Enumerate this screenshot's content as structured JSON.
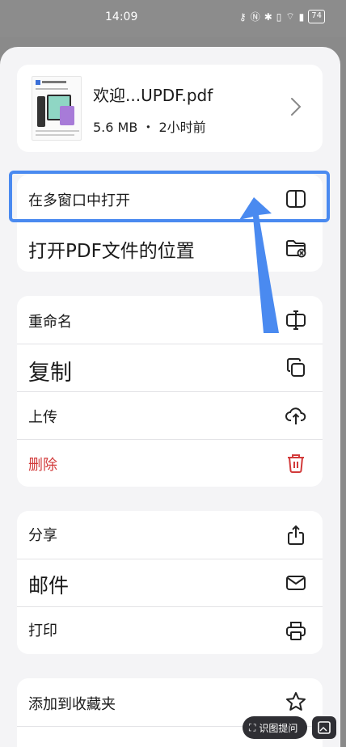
{
  "status_bar": {
    "time": "14:09",
    "battery": "74"
  },
  "file": {
    "name": "欢迎...UPDF.pdf",
    "meta": "5.6 MB ・ 2小时前"
  },
  "group1": [
    {
      "label": "在多窗口中打开",
      "icon": "split-window-icon"
    },
    {
      "label": "打开PDF文件的位置",
      "icon": "folder-icon"
    }
  ],
  "group2": [
    {
      "label": "重命名",
      "icon": "rename-cursor-icon"
    },
    {
      "label": "复制",
      "icon": "copy-icon"
    },
    {
      "label": "上传",
      "icon": "cloud-upload-icon"
    },
    {
      "label": "删除",
      "icon": "trash-icon"
    }
  ],
  "group3": [
    {
      "label": "分享",
      "icon": "share-icon"
    },
    {
      "label": "邮件",
      "icon": "mail-icon"
    },
    {
      "label": "打印",
      "icon": "printer-icon"
    }
  ],
  "group4": [
    {
      "label": "添加到收藏夹",
      "icon": "star-icon"
    }
  ],
  "overlay": {
    "recognize_label": "识图提问"
  },
  "colors": {
    "delete": "#d23a3a",
    "highlight": "#4a8af0",
    "arrow": "#4a8af0"
  }
}
